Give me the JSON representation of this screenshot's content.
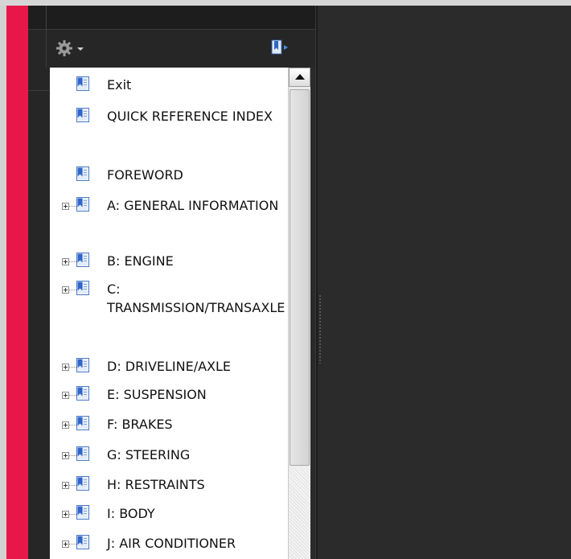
{
  "colors": {
    "accent_strip": "#e8174a",
    "panel_bg": "#262626",
    "doc_bg": "#2b2b2b",
    "tree_bg": "#ffffff"
  },
  "toolbar": {
    "options_icon": "gear-icon",
    "expand_icon": "bookmark-expand-icon"
  },
  "bookmarks": [
    {
      "label": "Exit",
      "expandable": false
    },
    {
      "label": "QUICK REFERENCE INDEX",
      "expandable": false
    },
    {
      "label": "FOREWORD",
      "expandable": false
    },
    {
      "label": "A: GENERAL INFORMATION",
      "expandable": true
    },
    {
      "label": "B: ENGINE",
      "expandable": true
    },
    {
      "label": "C: TRANSMISSION/TRANSAXLE",
      "expandable": true
    },
    {
      "label": "D: DRIVELINE/AXLE",
      "expandable": true
    },
    {
      "label": "E: SUSPENSION",
      "expandable": true
    },
    {
      "label": "F: BRAKES",
      "expandable": true
    },
    {
      "label": "G: STEERING",
      "expandable": true
    },
    {
      "label": "H: RESTRAINTS",
      "expandable": true
    },
    {
      "label": "I: BODY",
      "expandable": true
    },
    {
      "label": "J: AIR CONDITIONER",
      "expandable": true
    }
  ]
}
